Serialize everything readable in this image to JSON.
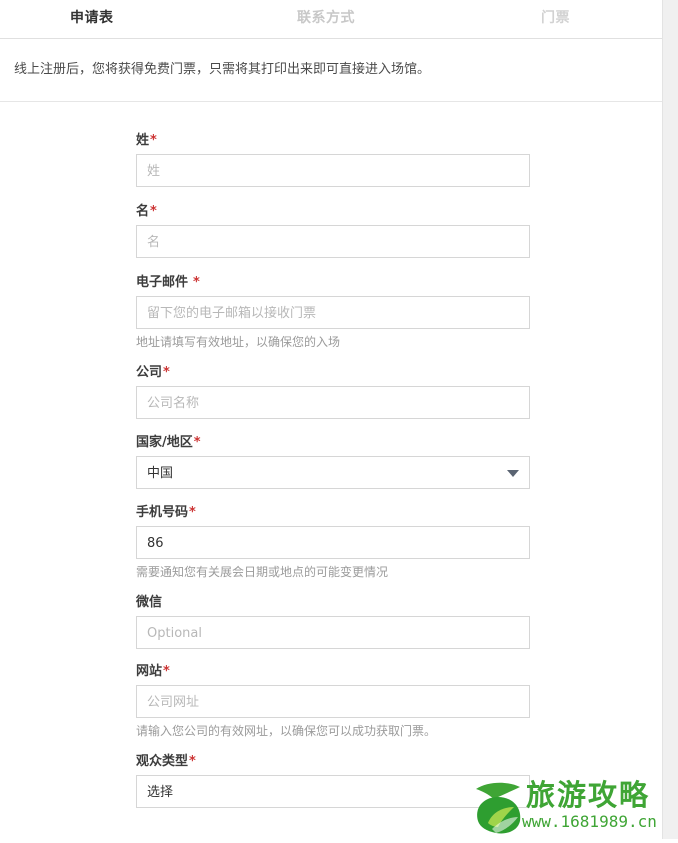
{
  "tabs": [
    {
      "label": "申请表",
      "active": true
    },
    {
      "label": "联系方式",
      "active": false
    },
    {
      "label": "门票",
      "active": false
    }
  ],
  "notice": {
    "text": "线上注册后，您将获得免费门票，只需将其打印出来即可直接进入场馆。"
  },
  "form": {
    "fields": [
      {
        "label": "姓",
        "required": true,
        "type": "text",
        "placeholder": "姓",
        "value": "",
        "hint": ""
      },
      {
        "label": "名",
        "required": true,
        "type": "text",
        "placeholder": "名",
        "value": "",
        "hint": ""
      },
      {
        "label": "电子邮件",
        "required": true,
        "type": "text",
        "placeholder": "留下您的电子邮箱以接收门票",
        "value": "",
        "hint": "地址请填写有效地址，以确保您的入场"
      },
      {
        "label": "公司",
        "required": true,
        "type": "text",
        "placeholder": "公司名称",
        "value": "",
        "hint": ""
      },
      {
        "label": "国家/地区",
        "required": true,
        "type": "select",
        "placeholder": "",
        "value": "中国",
        "hint": ""
      },
      {
        "label": "手机号码",
        "required": true,
        "type": "text",
        "placeholder": "",
        "value": "86",
        "hint": "需要通知您有关展会日期或地点的可能变更情况"
      },
      {
        "label": "微信",
        "required": false,
        "type": "text",
        "placeholder": "Optional",
        "value": "",
        "hint": ""
      },
      {
        "label": "网站",
        "required": true,
        "type": "text",
        "placeholder": "公司网址",
        "value": "",
        "hint": "请输入您公司的有效网址，以确保您可以成功获取门票。"
      },
      {
        "label": "观众类型",
        "required": true,
        "type": "select",
        "placeholder": "",
        "value": "选择",
        "hint": ""
      }
    ],
    "required_marker": "*"
  },
  "watermark": {
    "title": "旅游攻略",
    "url": "www.1681989.cn",
    "color": "#3fa535"
  }
}
